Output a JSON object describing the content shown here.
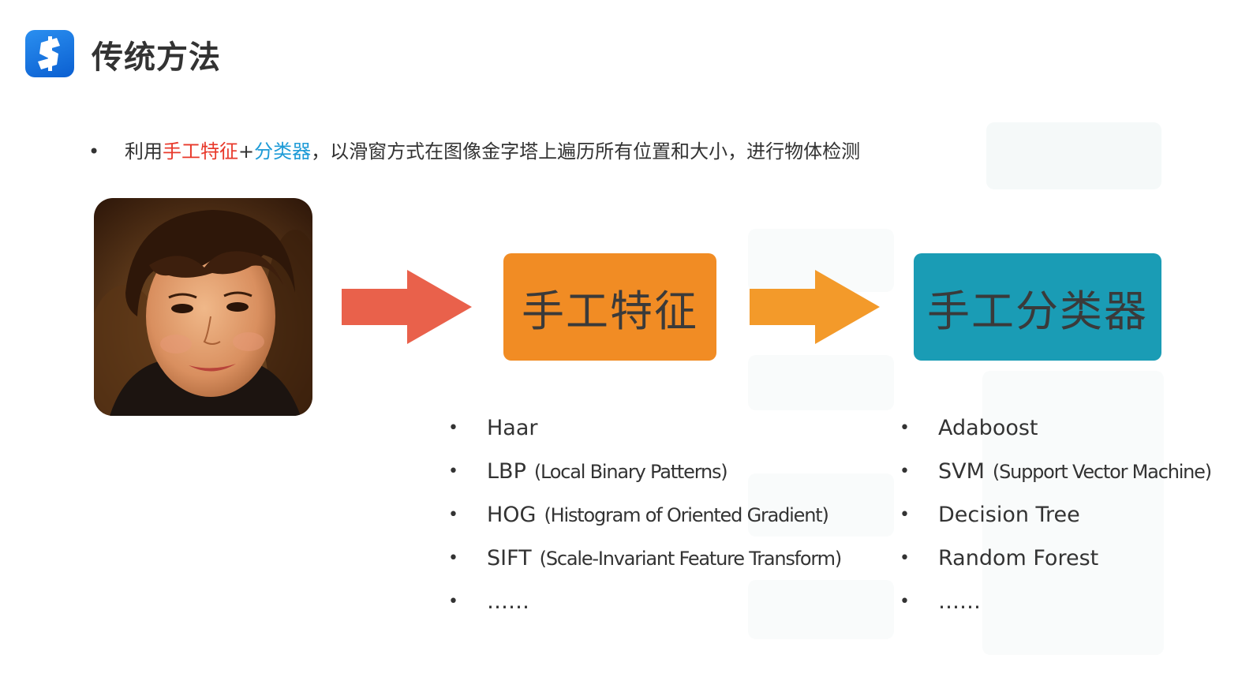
{
  "header": {
    "title": "传统方法"
  },
  "intro": {
    "bullet": "•",
    "prefix": "利用",
    "feature_term": "手工特征",
    "plus": "+",
    "classifier_term": "分类器",
    "suffix": "，以滑窗方式在图像金字塔上遍历所有位置和大小，进行物体检测"
  },
  "flow": {
    "feature_box": "手工特征",
    "classifier_box": "手工分类器",
    "arrow_colors": [
      "#e9614b",
      "#f39a2a"
    ]
  },
  "features": [
    {
      "name": "Haar",
      "detail": ""
    },
    {
      "name": "LBP",
      "detail": "(Local Binary Patterns)"
    },
    {
      "name": "HOG",
      "detail": "(Histogram of Oriented Gradient)"
    },
    {
      "name": "SIFT",
      "detail": "(Scale-Invariant Feature Transform)"
    },
    {
      "name": "……",
      "detail": ""
    }
  ],
  "classifiers": [
    {
      "name": "Adaboost",
      "detail": ""
    },
    {
      "name": "SVM",
      "detail": "(Support Vector Machine)"
    },
    {
      "name": "Decision Tree",
      "detail": ""
    },
    {
      "name": "Random Forest",
      "detail": ""
    },
    {
      "name": "……",
      "detail": ""
    }
  ],
  "colors": {
    "feature_box": "#f18c24",
    "classifier_box": "#1a9cb5",
    "highlight_red": "#e8392b",
    "highlight_blue": "#1e9bd7"
  }
}
